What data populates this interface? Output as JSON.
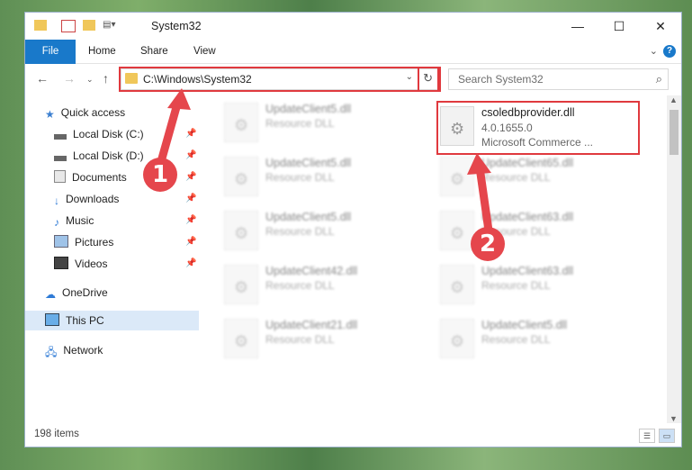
{
  "window": {
    "title": "System32"
  },
  "ribbon": {
    "tabs": [
      "File",
      "Home",
      "Share",
      "View"
    ]
  },
  "address": {
    "path": "C:\\Windows\\System32"
  },
  "search": {
    "placeholder": "Search System32"
  },
  "sidebar": {
    "items": [
      {
        "label": "Quick access",
        "icon": "star-icon"
      },
      {
        "label": "Local Disk (C:)",
        "icon": "drive-icon"
      },
      {
        "label": "Local Disk (D:)",
        "icon": "drive-icon"
      },
      {
        "label": "Documents",
        "icon": "documents-icon"
      },
      {
        "label": "Downloads",
        "icon": "download-icon"
      },
      {
        "label": "Music",
        "icon": "music-icon"
      },
      {
        "label": "Pictures",
        "icon": "pictures-icon"
      },
      {
        "label": "Videos",
        "icon": "videos-icon"
      },
      {
        "label": "OneDrive",
        "icon": "cloud-icon"
      },
      {
        "label": "This PC",
        "icon": "computer-icon"
      },
      {
        "label": "Network",
        "icon": "network-icon"
      }
    ]
  },
  "files": {
    "highlighted": {
      "name": "csoledbprovider.dll",
      "version": "4.0.1655.0",
      "company": "Microsoft Commerce ..."
    },
    "blurred_left": [
      {
        "name": "UpdateClient5.dll",
        "type": "Resource DLL"
      },
      {
        "name": "UpdateClient5.dll",
        "type": "Resource DLL"
      },
      {
        "name": "UpdateClient5.dll",
        "type": "Resource DLL"
      },
      {
        "name": "UpdateClient42.dll",
        "type": "Resource DLL"
      },
      {
        "name": "UpdateClient21.dll",
        "type": "Resource DLL"
      }
    ],
    "blurred_right": [
      {
        "name": "UpdateClient65.dll",
        "type": "Resource DLL"
      },
      {
        "name": "UpdateClient63.dll",
        "type": "Resource DLL"
      },
      {
        "name": "UpdateClient63.dll",
        "type": "Resource DLL"
      },
      {
        "name": "UpdateClient5.dll",
        "type": "Resource DLL"
      }
    ]
  },
  "status": {
    "count": "198 items"
  },
  "annotations": {
    "badge1": "1",
    "badge2": "2",
    "color": "#e5464c"
  }
}
